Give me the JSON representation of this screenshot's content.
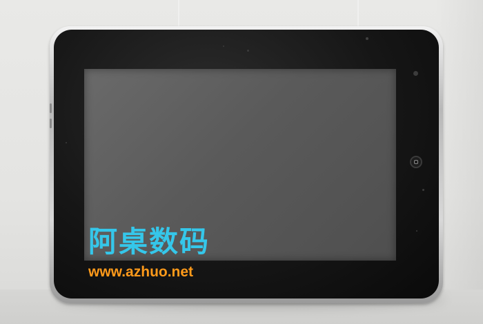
{
  "photo": {
    "subject": "tablet",
    "colors": {
      "wall": "#e6e6e4",
      "bezel": "#141414",
      "screen": "#5c5c5c",
      "frame": "#c0c0c0"
    },
    "home_button_icon": "home-button-icon"
  },
  "watermark": {
    "brand_cn": "阿桌数码",
    "url": "www.azhuo.net",
    "colors": {
      "brand_cn": "#35c7ea",
      "url": "#ff9a1a"
    }
  }
}
